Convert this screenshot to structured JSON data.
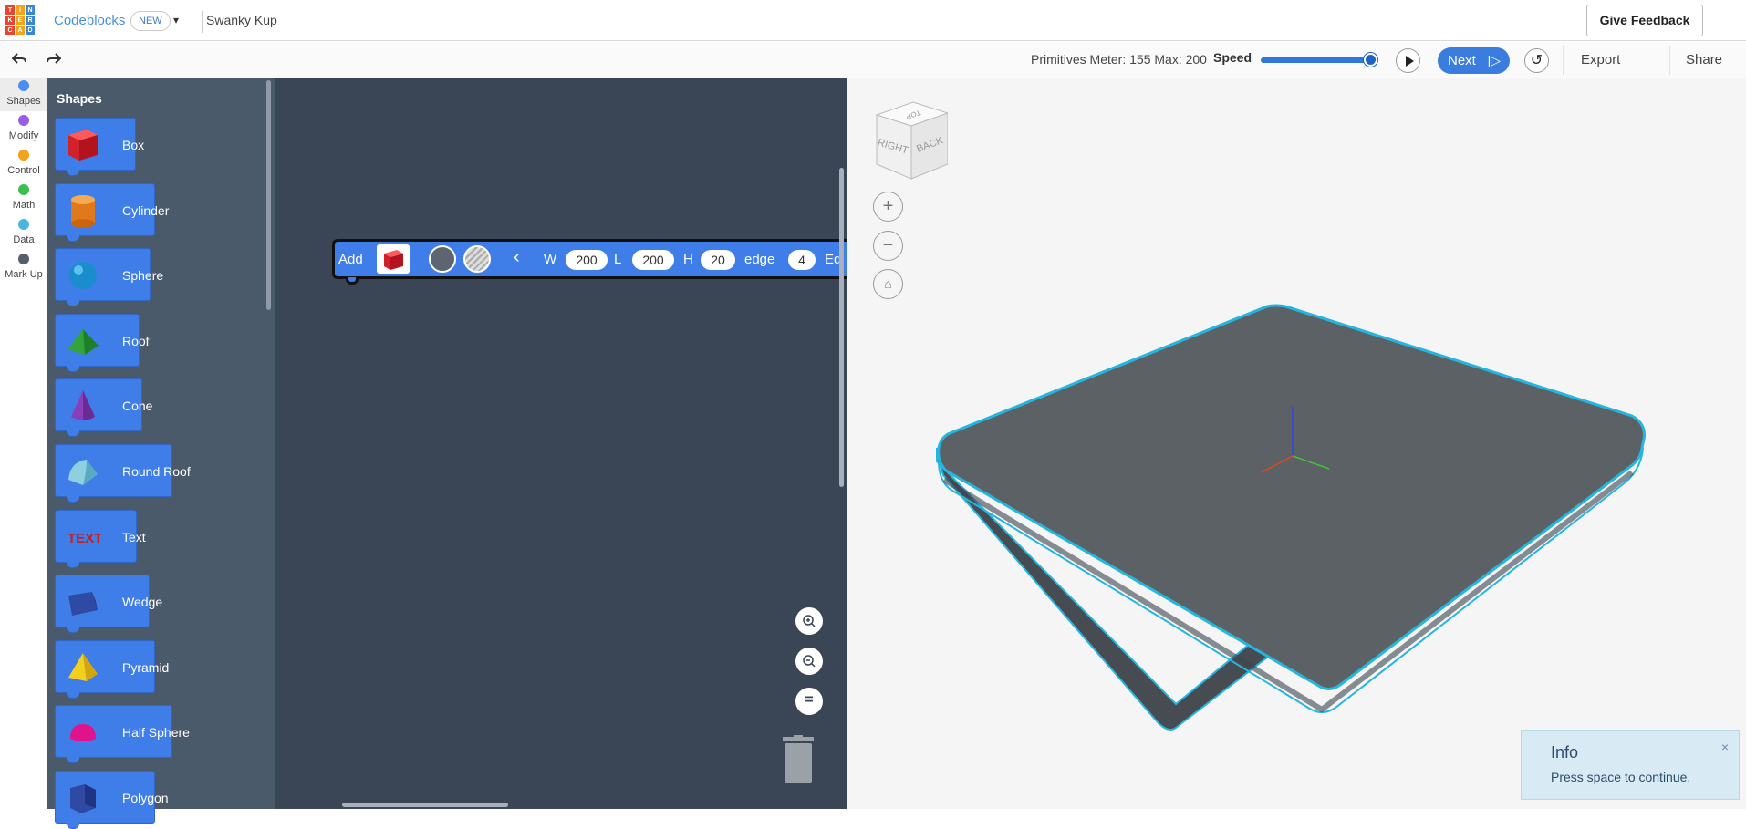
{
  "header": {
    "logo_letters": [
      "T",
      "I",
      "N",
      "K",
      "E",
      "R",
      "C",
      "A",
      "D"
    ],
    "logo_colors": [
      "#e8452c",
      "#f7a21b",
      "#3a86d4",
      "#e8452c",
      "#f7a21b",
      "#3a86d4",
      "#e8452c",
      "#f7a21b",
      "#3a86d4"
    ],
    "brand": "Codeblocks",
    "badge": "NEW",
    "project_name": "Swanky Kup",
    "feedback_button": "Give Feedback"
  },
  "toolbar": {
    "primitives_meter": "Primitives Meter: 155 Max: 200",
    "speed_label": "Speed",
    "speed_value": 1.0,
    "next_label": "Next",
    "export_label": "Export",
    "share_label": "Share"
  },
  "categories": [
    {
      "label": "Shapes",
      "color": "#4a8ef0",
      "active": true
    },
    {
      "label": "Modify",
      "color": "#9a5ee6",
      "active": false
    },
    {
      "label": "Control",
      "color": "#f2a21b",
      "active": false
    },
    {
      "label": "Math",
      "color": "#3cbf4a",
      "active": false
    },
    {
      "label": "Data",
      "color": "#4ab6e0",
      "active": false
    },
    {
      "label": "Mark Up",
      "color": "#55606e",
      "active": false
    }
  ],
  "flyout": {
    "title": "Shapes",
    "blocks": [
      {
        "label": "Box",
        "icon": "red-box-icon"
      },
      {
        "label": "Cylinder",
        "icon": "orange-cylinder-icon"
      },
      {
        "label": "Sphere",
        "icon": "blue-sphere-icon"
      },
      {
        "label": "Roof",
        "icon": "green-roof-icon"
      },
      {
        "label": "Cone",
        "icon": "purple-cone-icon"
      },
      {
        "label": "Round Roof",
        "icon": "teal-round-roof-icon"
      },
      {
        "label": "Text",
        "icon": "red-text-icon"
      },
      {
        "label": "Wedge",
        "icon": "navy-wedge-icon"
      },
      {
        "label": "Pyramid",
        "icon": "yellow-pyramid-icon"
      },
      {
        "label": "Half Sphere",
        "icon": "magenta-half-sphere-icon"
      },
      {
        "label": "Polygon",
        "icon": "navy-polygon-icon"
      }
    ]
  },
  "workspace_block": {
    "add_label": "Add",
    "w_label": "W",
    "w_value": "200",
    "l_label": "L",
    "l_value": "200",
    "h_label": "H",
    "h_value": "20",
    "edge_label": "edge",
    "edge_value": "4",
    "trailing_label": "Ed"
  },
  "viewcube": {
    "top": "TOP",
    "right": "RIGHT",
    "back": "BACK"
  },
  "info_toast": {
    "title": "Info",
    "body": "Press space to continue.",
    "close": "×"
  }
}
